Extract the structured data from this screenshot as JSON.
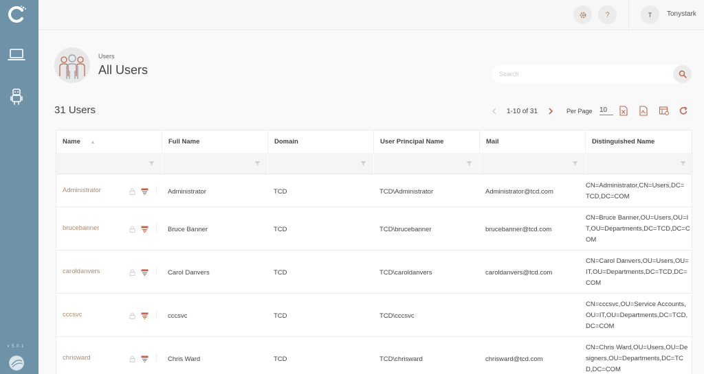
{
  "app": {
    "version": "v 5.0.1",
    "user_initial": "T",
    "username": "Tonystark"
  },
  "header": {
    "breadcrumb": "Users",
    "title": "All Users"
  },
  "search": {
    "placeholder": "Search",
    "value": ""
  },
  "summary": {
    "count_label": "31 Users"
  },
  "pagination": {
    "range": "1-10 of 31",
    "per_page_label": "Per Page",
    "per_page_value": "10"
  },
  "table": {
    "columns": [
      "Name",
      "Full Name",
      "Domain",
      "User Principal Name",
      "Mail",
      "Distinguished Name"
    ],
    "sort_indicator": "▲",
    "rows": [
      {
        "name": "Administrator",
        "full_name": "Administrator",
        "domain": "TCD",
        "upn": "TCD\\Administrator",
        "mail": "Administrator@tcd.com",
        "dn": [
          "CN=Administrator,CN=Users,DC=",
          "TCD,DC=COM"
        ]
      },
      {
        "name": "brucebanner",
        "full_name": "Bruce Banner",
        "domain": "TCD",
        "upn": "TCD\\brucebanner",
        "mail": "brucebanner@tcd.com",
        "dn": [
          "CN=Bruce Banner,OU=Users,OU=I",
          "T,OU=Departments,DC=TCD,DC=C",
          "OM"
        ]
      },
      {
        "name": "caroldanvers",
        "full_name": "Carol Danvers",
        "domain": "TCD",
        "upn": "TCD\\caroldanvers",
        "mail": "caroldanvers@tcd.com",
        "dn": [
          "CN=Carol Danvers,OU=Users,OU=",
          "IT,OU=Departments,DC=TCD,DC=",
          "COM"
        ]
      },
      {
        "name": "cccsvc",
        "full_name": "cccsvc",
        "domain": "TCD",
        "upn": "TCD\\cccsvc",
        "mail": "",
        "dn": [
          "CN=cccsvc,OU=Service Accounts,",
          "OU=IT,OU=Departments,DC=TCD,",
          "DC=COM"
        ]
      },
      {
        "name": "chrisward",
        "full_name": "Chris Ward",
        "domain": "TCD",
        "upn": "TCD\\chrisward",
        "mail": "chrisward@tcd.com",
        "dn": [
          "CN=Chris Ward,OU=Users,OU=De",
          "signers,OU=Departments,DC=TC",
          "D,DC=COM"
        ]
      }
    ]
  },
  "icons": {
    "logo": "c-logo-icon",
    "nav": [
      "laptop-icon",
      "robot-icon"
    ],
    "topbar": [
      "gear-icon",
      "help-icon"
    ],
    "toolbar": [
      "export-excel-icon",
      "export-pdf-icon",
      "column-settings-icon",
      "refresh-icon"
    ],
    "row": [
      "lock-icon",
      "details-icon"
    ]
  },
  "colors": {
    "sidebar": "#6e93a8",
    "link": "#b08a6b",
    "accent": "#c0674e"
  }
}
